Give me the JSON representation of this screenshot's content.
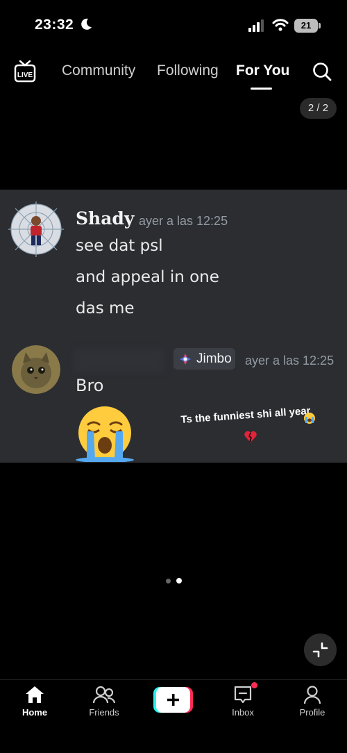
{
  "status_bar": {
    "time": "23:32",
    "battery": "21"
  },
  "top_nav": {
    "tabs": [
      {
        "label": "Community"
      },
      {
        "label": "Following"
      },
      {
        "label": "For You"
      }
    ],
    "counter": "2 / 2"
  },
  "post": {
    "messages": [
      {
        "author": "Shady",
        "timestamp": "ayer a las 12:25",
        "lines": [
          "see dat psl",
          "and appeal in one",
          "das me"
        ]
      },
      {
        "tag": "Jimbo",
        "timestamp": "ayer a las 12:25",
        "text": "Bro"
      }
    ],
    "caption": "Ts the funniest shi all year"
  },
  "bottom_nav": {
    "items": [
      {
        "label": "Home"
      },
      {
        "label": "Friends"
      },
      {
        "label": "Inbox"
      },
      {
        "label": "Profile"
      }
    ]
  },
  "colors": {
    "accent": "#fe2c55",
    "card_bg": "#2b2d31"
  }
}
